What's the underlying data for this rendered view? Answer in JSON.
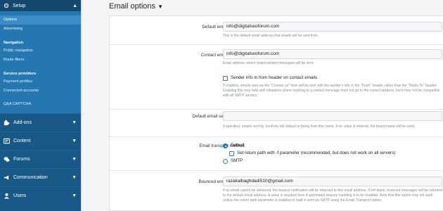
{
  "sidebar": {
    "setup": {
      "label": "Setup",
      "icon": "cog-icon"
    },
    "setup_items": [
      "Options",
      "Advertising"
    ],
    "nav_label": "Navigation",
    "nav_items": [
      "Public navigation",
      "Route filters"
    ],
    "sp_label": "Service providers",
    "sp_items": [
      "Payment profiles",
      "Connected accounts"
    ],
    "extra_item": "Q&A CAPTCHA",
    "sections": [
      {
        "label": "Add-ons",
        "icon": "puzzle-icon"
      },
      {
        "label": "Content",
        "icon": "content-icon"
      },
      {
        "label": "Forums",
        "icon": "forums-icon"
      },
      {
        "label": "Communication",
        "icon": "megaphone-icon"
      },
      {
        "label": "Users",
        "icon": "user-icon"
      }
    ]
  },
  "page": {
    "title": "Email options"
  },
  "fields": {
    "default_email": {
      "label": "Default email address:",
      "value": "info@digitalseoforum.com",
      "hint": "This is the default email address that emails will be sent from."
    },
    "contact_email": {
      "label": "Contact email address:",
      "value": "info@digitalseoforum.com",
      "hint": "Email address where board-related messages will be sent."
    },
    "sender_info": {
      "label": "Sender info in from header on contact emails",
      "hint": "If enabled, emails sent via the \"Contact us\" form will be sent with the sender's info in the \"From\" header rather than the \"Reply-To\" header. Enabling this may help with situations where replying to a contact message does not go to the correct address, but it may not be compatible with all SMTP servers."
    },
    "sender_name": {
      "label": "Default email sender name:",
      "value": "",
      "hint": "If specified, emails sent by XenForo will default to being from this name. If no value is entered, the board name will be used."
    },
    "transport": {
      "label": "Email transport method:",
      "opt_default": "Default",
      "opt_return_path": "Set return path with -f parameter (recommended, but does not work on all servers)",
      "opt_smtp": "SMTP"
    },
    "bounced_email": {
      "label": "Bounced email address:",
      "value": "razakalbaghdadi510@gmail.com",
      "hint": "If an email cannot be delivered, the bounce notification will be returned to this email address. If left blank, bounced messages will be returned to the default email address. A value is required here if automated bounce handling is to be enabled. Note that this option may not work unless the return path parameter is enabled or mail is sent via SMTP using the Email Transport option."
    }
  }
}
